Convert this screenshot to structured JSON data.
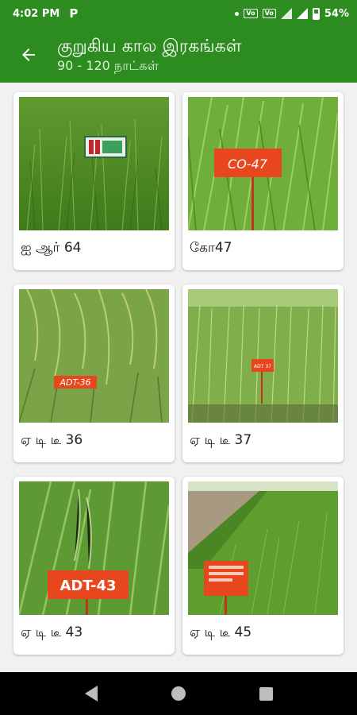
{
  "status": {
    "time": "4:02 PM",
    "app_badge": "P",
    "battery": "54%"
  },
  "header": {
    "title": "குறுகிய கால இரகங்கள்",
    "subtitle": "90 - 120 நாட்கள்"
  },
  "varieties": [
    {
      "name": "ஐ ஆர் 64",
      "sign": ""
    },
    {
      "name": "கோ47",
      "sign": "CO-47"
    },
    {
      "name": "ஏ டி டீ 36",
      "sign": "ADT-36"
    },
    {
      "name": "ஏ டி டீ 37",
      "sign": "ADT 37"
    },
    {
      "name": "ஏ டி டீ 43",
      "sign": "ADT-43"
    },
    {
      "name": "ஏ டி டீ 45",
      "sign": ""
    }
  ],
  "colors": {
    "brand": "#2c8c1f",
    "sign": "#e8461c"
  }
}
